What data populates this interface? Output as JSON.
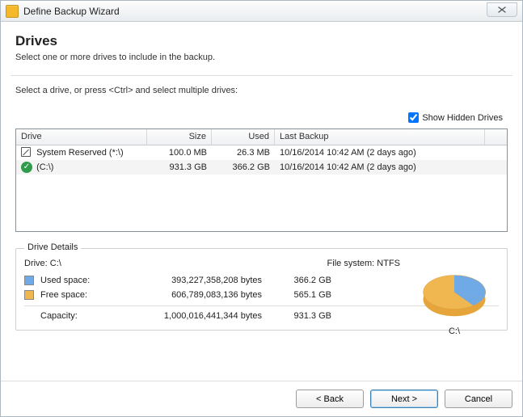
{
  "window": {
    "title": "Define Backup Wizard"
  },
  "header": {
    "title": "Drives",
    "subtitle": "Select one or more drives to include in the backup."
  },
  "instruction": "Select a drive, or press <Ctrl> and select multiple drives:",
  "show_hidden": {
    "label": "Show Hidden Drives",
    "checked": true
  },
  "grid": {
    "columns": {
      "drive": "Drive",
      "size": "Size",
      "used": "Used",
      "last_backup": "Last Backup"
    },
    "rows": [
      {
        "icon": "system",
        "drive": "System Reserved (*:\\)",
        "size": "100.0 MB",
        "used": "26.3 MB",
        "last_backup": "10/16/2014 10:42 AM (2 days ago)"
      },
      {
        "icon": "check",
        "drive": "(C:\\)",
        "size": "931.3 GB",
        "used": "366.2 GB",
        "last_backup": "10/16/2014 10:42 AM (2 days ago)"
      }
    ]
  },
  "details": {
    "legend": "Drive Details",
    "drive_label": "Drive: C:\\",
    "fs_label": "File system: NTFS",
    "used": {
      "label": "Used space:",
      "bytes": "393,227,358,208 bytes",
      "gb": "366.2 GB"
    },
    "free": {
      "label": "Free space:",
      "bytes": "606,789,083,136 bytes",
      "gb": "565.1 GB"
    },
    "capacity": {
      "label": "Capacity:",
      "bytes": "1,000,016,441,344 bytes",
      "gb": "931.3 GB"
    },
    "chart_caption": "C:\\"
  },
  "footer": {
    "back": "< Back",
    "next": "Next >",
    "cancel": "Cancel"
  },
  "chart_data": {
    "type": "pie",
    "title": "C:\\",
    "series": [
      {
        "name": "Used space",
        "value": 366.2,
        "unit": "GB",
        "color": "#6fa9e6"
      },
      {
        "name": "Free space",
        "value": 565.1,
        "unit": "GB",
        "color": "#f0b750"
      }
    ]
  }
}
